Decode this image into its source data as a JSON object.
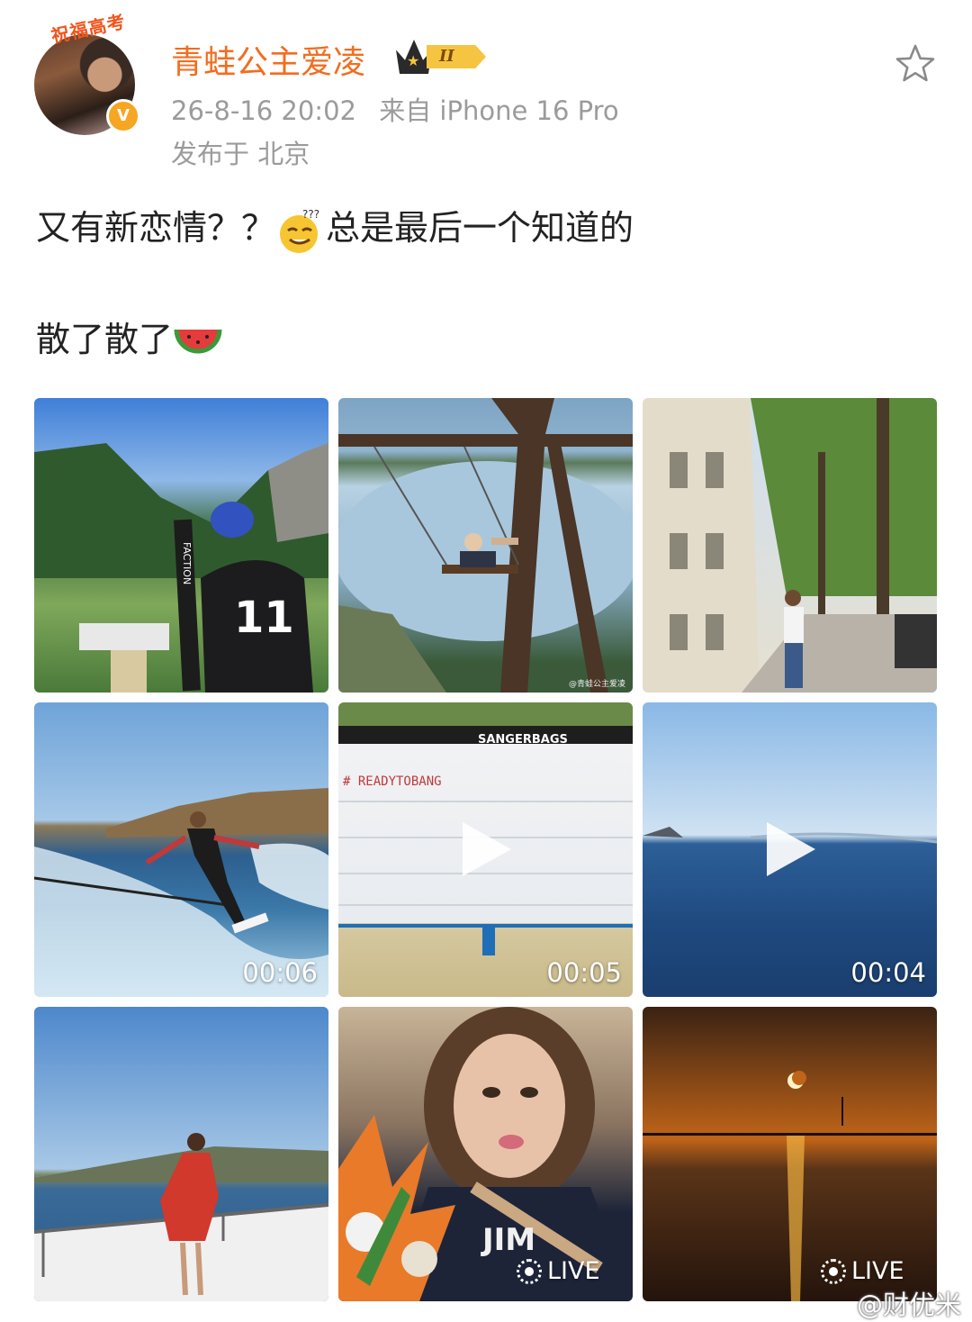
{
  "profile": {
    "frame_text": "祝福高考",
    "username": "青蛙公主爱凌",
    "rank_label": "II",
    "verified_mark": "V",
    "timestamp": "26-8-16 20:02",
    "source": "来自 iPhone 16 Pro",
    "location": "发布于 北京"
  },
  "post": {
    "line1_a": "又有新恋情？？",
    "line1_b": "总是最后一个知道的",
    "line2": "散了散了"
  },
  "media": [
    {
      "kind": "photo",
      "desc": "skier-mountain",
      "slogan": "11",
      "brand": "FACTION"
    },
    {
      "kind": "photo",
      "desc": "swing-lake",
      "small_watermark": "@青蛙公主爱凌"
    },
    {
      "kind": "photo",
      "desc": "paris-street"
    },
    {
      "kind": "video",
      "desc": "wakeboard",
      "duration": "00:06"
    },
    {
      "kind": "video",
      "desc": "bag-jump",
      "duration": "00:05",
      "banner": "SANGERBAGS",
      "scrawl": "# READYTOBANG"
    },
    {
      "kind": "video",
      "desc": "sea",
      "duration": "00:04"
    },
    {
      "kind": "photo",
      "desc": "boat-dress"
    },
    {
      "kind": "live",
      "desc": "selfie-flowers",
      "badge": "LIVE",
      "shirt_text": "JIM"
    },
    {
      "kind": "live",
      "desc": "sunset-eclipse",
      "badge": "LIVE"
    }
  ],
  "watermark": "@财优米",
  "icons": {
    "favorite": "star-outline-icon"
  },
  "colors": {
    "username": "#f26d1f",
    "meta": "#9b9b9b",
    "rank_gold": "#f5c542"
  }
}
